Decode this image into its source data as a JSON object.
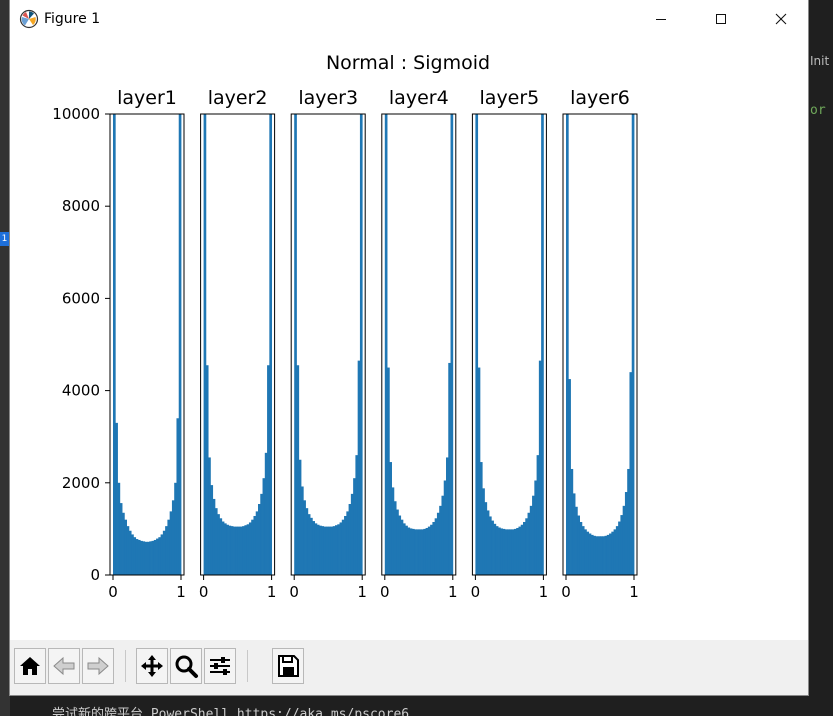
{
  "window": {
    "title": "Figure 1"
  },
  "background": {
    "right_text": "Init",
    "right_code": "or",
    "bottom_text": "尝试新的跨平台 PowerShell https://aka.ms/pscore6",
    "badge": "1"
  },
  "toolbar": {
    "icons": [
      "home-icon",
      "back-icon",
      "forward-icon",
      "pan-icon",
      "zoom-icon",
      "configure-subplots-icon",
      "save-icon"
    ]
  },
  "chart_data": {
    "type": "bar",
    "title": "Normal : Sigmoid",
    "ylim": [
      0,
      10000
    ],
    "y_ticks": [
      0,
      2000,
      4000,
      6000,
      8000,
      10000
    ],
    "x_ticks": [
      "0",
      "1"
    ],
    "xlim": [
      0,
      1
    ],
    "bins": 30,
    "color": "#1f77b4",
    "subplots": [
      {
        "title": "layer1",
        "values": [
          10000,
          3300,
          2000,
          1560,
          1350,
          1200,
          1060,
          960,
          880,
          820,
          780,
          760,
          740,
          730,
          720,
          720,
          730,
          740,
          760,
          790,
          820,
          880,
          960,
          1060,
          1200,
          1380,
          1620,
          2000,
          3400,
          10000
        ]
      },
      {
        "title": "layer2",
        "values": [
          10000,
          4550,
          2550,
          1950,
          1650,
          1450,
          1320,
          1230,
          1160,
          1120,
          1090,
          1070,
          1060,
          1050,
          1050,
          1050,
          1050,
          1060,
          1080,
          1100,
          1140,
          1200,
          1280,
          1380,
          1540,
          1760,
          2100,
          2650,
          4550,
          10000
        ]
      },
      {
        "title": "layer3",
        "values": [
          10000,
          4550,
          2500,
          1920,
          1620,
          1450,
          1320,
          1240,
          1170,
          1120,
          1090,
          1070,
          1060,
          1050,
          1050,
          1050,
          1050,
          1060,
          1080,
          1100,
          1140,
          1200,
          1280,
          1380,
          1540,
          1760,
          2100,
          2600,
          4650,
          10000
        ]
      },
      {
        "title": "layer4",
        "values": [
          10000,
          4500,
          2450,
          1900,
          1600,
          1420,
          1290,
          1200,
          1120,
          1070,
          1030,
          1010,
          1000,
          990,
          990,
          990,
          990,
          1000,
          1020,
          1050,
          1090,
          1150,
          1230,
          1350,
          1500,
          1720,
          2050,
          2550,
          4600,
          10000
        ]
      },
      {
        "title": "layer5",
        "values": [
          10000,
          4500,
          2450,
          1880,
          1580,
          1400,
          1270,
          1180,
          1110,
          1060,
          1030,
          1010,
          1000,
          990,
          990,
          990,
          990,
          1000,
          1020,
          1050,
          1090,
          1150,
          1230,
          1350,
          1500,
          1720,
          2050,
          2600,
          4650,
          10000
        ]
      },
      {
        "title": "layer6",
        "values": [
          10000,
          4250,
          2300,
          1770,
          1480,
          1290,
          1150,
          1060,
          990,
          940,
          900,
          870,
          850,
          840,
          840,
          840,
          840,
          850,
          870,
          900,
          940,
          990,
          1060,
          1160,
          1300,
          1500,
          1800,
          2300,
          4400,
          10000
        ]
      }
    ]
  }
}
